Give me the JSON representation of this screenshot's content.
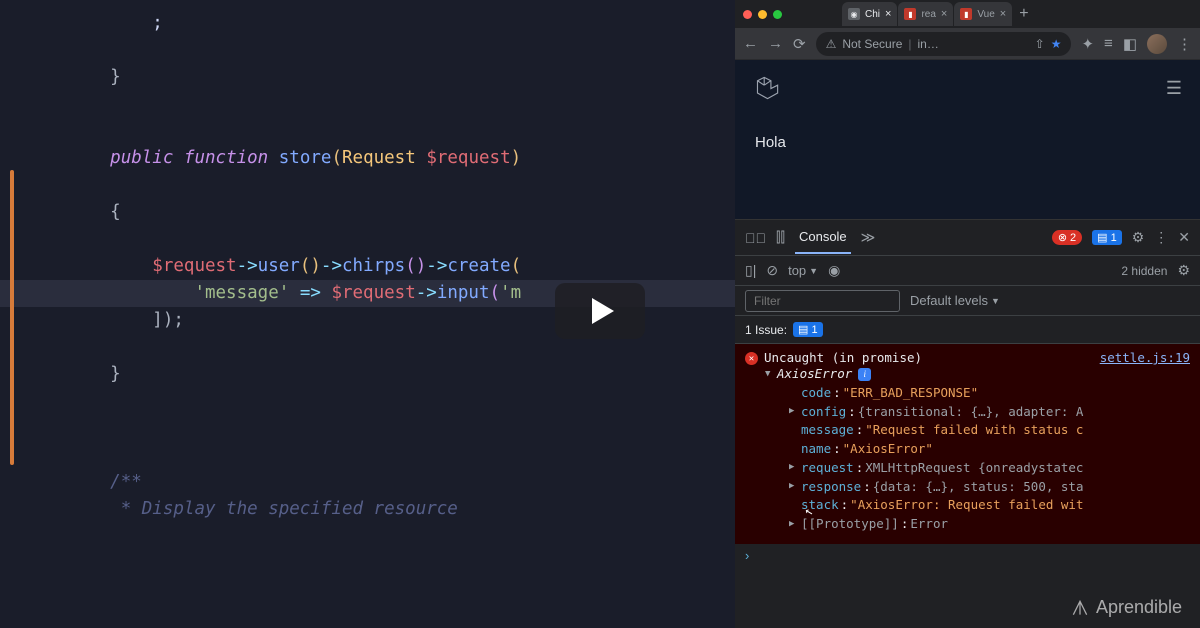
{
  "editor": {
    "kw_public": "public",
    "kw_function": "function",
    "fn_name": "store",
    "param_type": "Request",
    "param_var": "$request",
    "var_request": "$request",
    "m_user": "user",
    "m_chirps": "chirps",
    "m_create": "create",
    "key_message": "'message'",
    "arrow": "=>",
    "m_input": "input",
    "input_arg": "'m",
    "close_array": "]);",
    "brace_open": "{",
    "brace_close": "}",
    "comment_open": "/**",
    "comment_line": " * Display the specified resource"
  },
  "browser": {
    "traffic": {
      "red": "#ff5f57",
      "yellow": "#febc2e",
      "green": "#28c840"
    },
    "tabs": [
      {
        "label": "Chi",
        "favicon_bg": "#5f6368"
      },
      {
        "label": "rea",
        "favicon_bg": "#c0392b"
      },
      {
        "label": "Vue",
        "favicon_bg": "#c0392b"
      }
    ],
    "address": {
      "warning": "Not Secure",
      "url": "in…"
    },
    "page": {
      "greeting": "Hola"
    },
    "devtools": {
      "tab_console": "Console",
      "more": "≫",
      "err_count": "2",
      "info_count": "1",
      "context": "top",
      "filter_placeholder": "Filter",
      "levels": "Default levels",
      "hidden": "2 hidden",
      "issues_label": "1 Issue:",
      "issues_count": "1",
      "error": {
        "header": "Uncaught (in promise)",
        "source": "settle.js:19",
        "title": "AxiosError",
        "props": [
          {
            "key": "code",
            "val": "\"ERR_BAD_RESPONSE\"",
            "type": "str",
            "expand": ""
          },
          {
            "key": "config",
            "val": "{transitional: {…}, adapter: A",
            "type": "obj",
            "expand": "▶"
          },
          {
            "key": "message",
            "val": "\"Request failed with status c",
            "type": "str",
            "expand": ""
          },
          {
            "key": "name",
            "val": "\"AxiosError\"",
            "type": "str",
            "expand": ""
          },
          {
            "key": "request",
            "val": "XMLHttpRequest {onreadystatec",
            "type": "obj",
            "expand": "▶"
          },
          {
            "key": "response",
            "val": "{data: {…}, status: 500, sta",
            "type": "obj",
            "expand": "▶"
          },
          {
            "key": "stack",
            "val": "\"AxiosError: Request failed wit",
            "type": "str",
            "expand": ""
          },
          {
            "key": "[[Prototype]]",
            "val": "Error",
            "type": "obj",
            "expand": "▶"
          }
        ]
      }
    }
  },
  "watermark": "Aprendible"
}
